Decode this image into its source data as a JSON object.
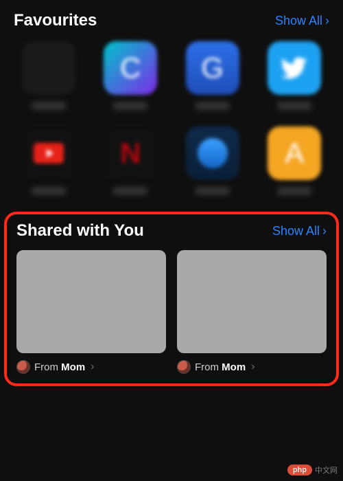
{
  "favourites": {
    "title": "Favourites",
    "show_all": "Show All",
    "items": [
      {
        "name": "Work"
      },
      {
        "name": "Canva",
        "glyph": "C"
      },
      {
        "name": "Gmail",
        "glyph": "G"
      },
      {
        "name": "Twitter",
        "glyph": ""
      },
      {
        "name": "YouTube"
      },
      {
        "name": "Netflix",
        "glyph": "N"
      },
      {
        "name": "Prime Video"
      },
      {
        "name": "Amazon",
        "glyph": "A"
      }
    ]
  },
  "shared": {
    "title": "Shared with You",
    "show_all": "Show All",
    "cards": [
      {
        "from_prefix": "From ",
        "from_name": "Mom"
      },
      {
        "from_prefix": "From ",
        "from_name": "Mom"
      }
    ]
  },
  "watermark": {
    "badge": "php",
    "text": "中文网"
  },
  "colors": {
    "accent": "#2a84ff",
    "highlight_border": "#ff2a1a"
  }
}
